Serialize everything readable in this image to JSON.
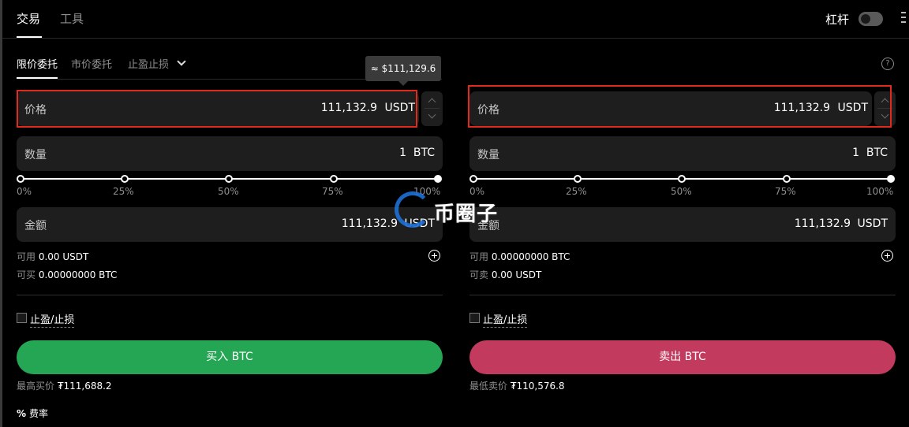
{
  "header": {
    "tabs": [
      {
        "label": "交易"
      },
      {
        "label": "工具"
      }
    ],
    "leverage_label": "杠杆",
    "leverage_on": false
  },
  "order_tabs": [
    {
      "label": "限价委托"
    },
    {
      "label": "市价委托"
    },
    {
      "label": "止盈止损"
    }
  ],
  "tooltip": "≈ $111,129.6",
  "buy": {
    "price_label": "价格",
    "price_value": "111,132.9",
    "price_unit": "USDT",
    "qty_label": "数量",
    "qty_value": "1",
    "qty_unit": "BTC",
    "slider_ticks": [
      "0%",
      "25%",
      "50%",
      "75%",
      "100%"
    ],
    "slider_fraction": 1.0,
    "amount_label": "金额",
    "amount_value": "111,132.9",
    "amount_unit": "USDT",
    "avail_label": "可用",
    "avail_value": "0.00 USDT",
    "can_label": "可买",
    "can_value": "0.00000000 BTC",
    "tpsl_label": "止盈/止损",
    "button_label": "买入 BTC",
    "best_label": "最高买价",
    "best_value": "₮111,688.2"
  },
  "sell": {
    "price_label": "价格",
    "price_value": "111,132.9",
    "price_unit": "USDT",
    "qty_label": "数量",
    "qty_value": "1",
    "qty_unit": "BTC",
    "slider_ticks": [
      "0%",
      "25%",
      "50%",
      "75%",
      "100%"
    ],
    "slider_fraction": 1.0,
    "amount_label": "金额",
    "amount_value": "111,132.9",
    "amount_unit": "USDT",
    "avail_label": "可用",
    "avail_value": "0.00000000 BTC",
    "can_label": "可卖",
    "can_value": "0.00 USDT",
    "tpsl_label": "止盈/止损",
    "button_label": "卖出 BTC",
    "best_label": "最低卖价",
    "best_value": "₮110,576.8"
  },
  "fee": {
    "icon": "%",
    "label": "费率"
  },
  "watermark": "币圈子",
  "colors": {
    "buy": "#24a654",
    "sell": "#c23a5e",
    "highlight": "#e02a1e",
    "watermark": "#1d6fd8"
  },
  "icons": [
    "more-icon",
    "help-icon",
    "chevron-down-icon",
    "plus-circle-icon",
    "percent-icon"
  ]
}
